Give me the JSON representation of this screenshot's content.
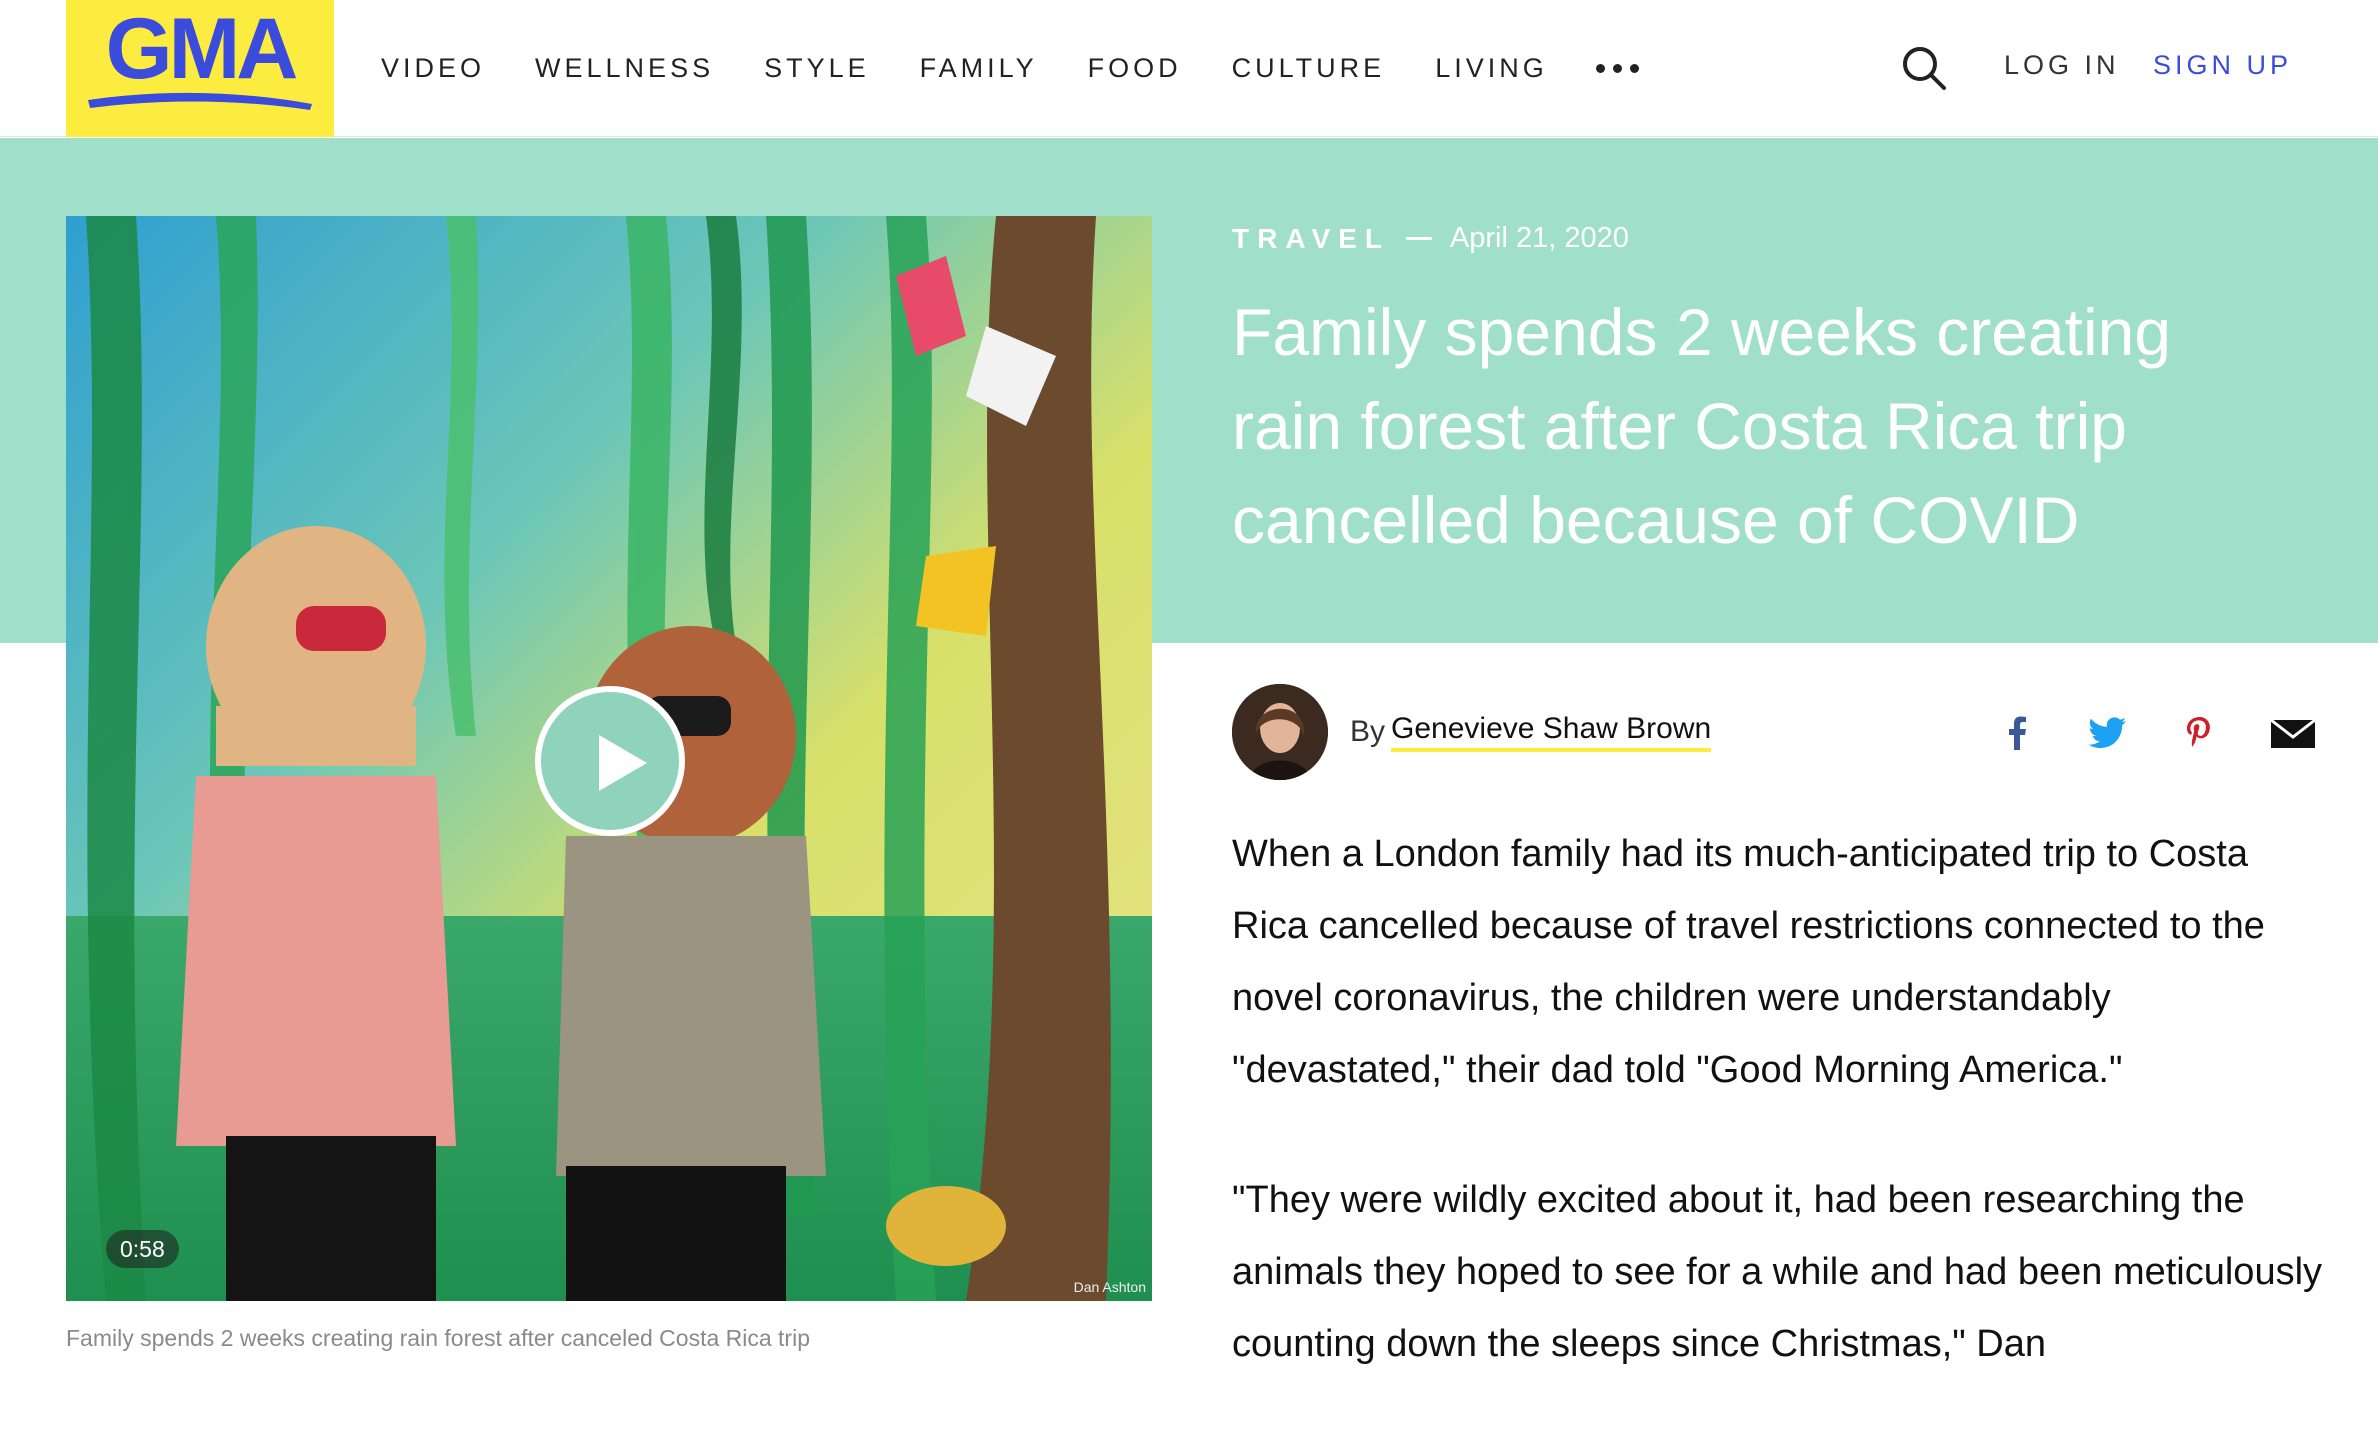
{
  "header": {
    "logo_text": "GMA",
    "nav": [
      "VIDEO",
      "WELLNESS",
      "STYLE",
      "FAMILY",
      "FOOD",
      "CULTURE",
      "LIVING"
    ],
    "login_label": "LOG IN",
    "signup_label": "SIGN UP",
    "icons": {
      "search": "search-icon",
      "more": "more-dots-icon"
    }
  },
  "video": {
    "duration": "0:58",
    "credit": "Dan Ashton",
    "caption": "Family spends 2 weeks creating rain forest after canceled Costa Rica trip",
    "play_icon": "play-icon"
  },
  "article": {
    "section": "TRAVEL",
    "date": "April 21, 2020",
    "headline": "Family spends 2 weeks creating rain forest after Costa Rica trip cancelled because of COVID",
    "by_label": "By",
    "author": "Genevieve Shaw Brown",
    "share_icons": [
      "facebook-icon",
      "twitter-icon",
      "pinterest-icon",
      "email-icon"
    ],
    "paragraphs": [
      "When a London family had its much-anticipated trip to Costa Rica cancelled because of travel restrictions connected to the novel coronavirus, the children were understandably \"devastated,\" their dad told \"Good Morning America.\"",
      "\"They were wildly excited about it, had been researching the animals they hoped to see for a while and had been meticulously counting down the sleeps since Christmas,\" Dan"
    ]
  },
  "colors": {
    "brand_yellow": "#fcec3f",
    "brand_blue": "#3b4cdc",
    "hero_mint": "#a0dfc9",
    "play_mint": "#8fd3bd"
  }
}
